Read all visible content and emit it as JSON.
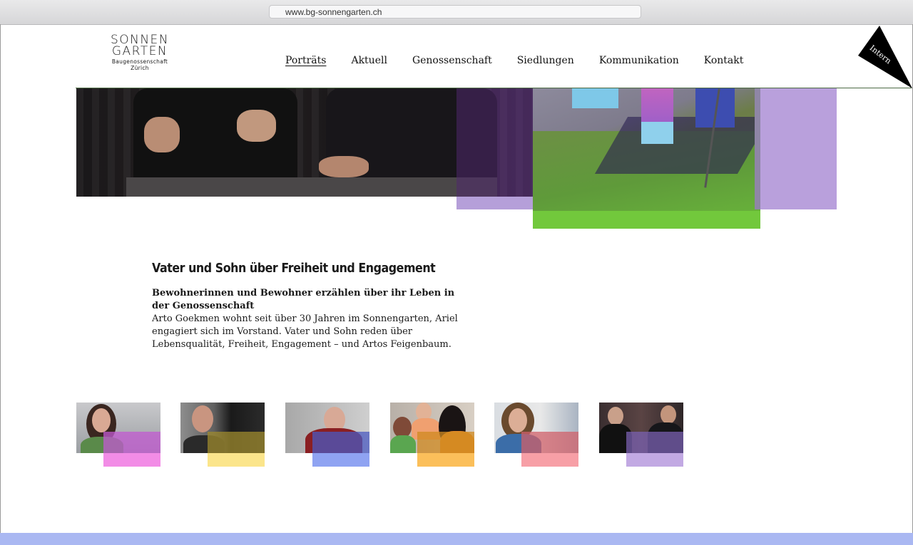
{
  "browser": {
    "url": "www.bg-sonnengarten.ch"
  },
  "logo": {
    "line1": "SONNEN",
    "line2": "GARTEN",
    "tagline": "Baugenossenschaft Zürich"
  },
  "nav": {
    "items": [
      {
        "label": "Porträts",
        "active": true
      },
      {
        "label": "Aktuell",
        "active": false
      },
      {
        "label": "Genossenschaft",
        "active": false
      },
      {
        "label": "Siedlungen",
        "active": false
      },
      {
        "label": "Kommunikation",
        "active": false
      },
      {
        "label": "Kontakt",
        "active": false
      }
    ]
  },
  "intern": {
    "label": "Intern"
  },
  "article": {
    "title": "Vater und Sohn über Freiheit und Engagement",
    "lead": "Bewohnerinnen und Bewohner erzählen über ihr Leben in der Genossenschaft",
    "body": "Arto Goekmen wohnt seit über 30 Jahren im Sonnengarten, Ariel engagiert sich im Vorstand. Vater und Sohn reden über Lebensqualität, Freiheit, Engagement – und Artos Feigenbaum."
  },
  "thumbnails": [
    {
      "accent": "#f28ce6"
    },
    {
      "accent": "#fbe58b"
    },
    {
      "accent": "#8fa3f2"
    },
    {
      "accent": "#fbbf5a"
    },
    {
      "accent": "#f79fa6"
    },
    {
      "accent": "#c2a9e3"
    }
  ],
  "colors": {
    "footer": "#aab8f2",
    "header_line": "#4d6b44"
  }
}
